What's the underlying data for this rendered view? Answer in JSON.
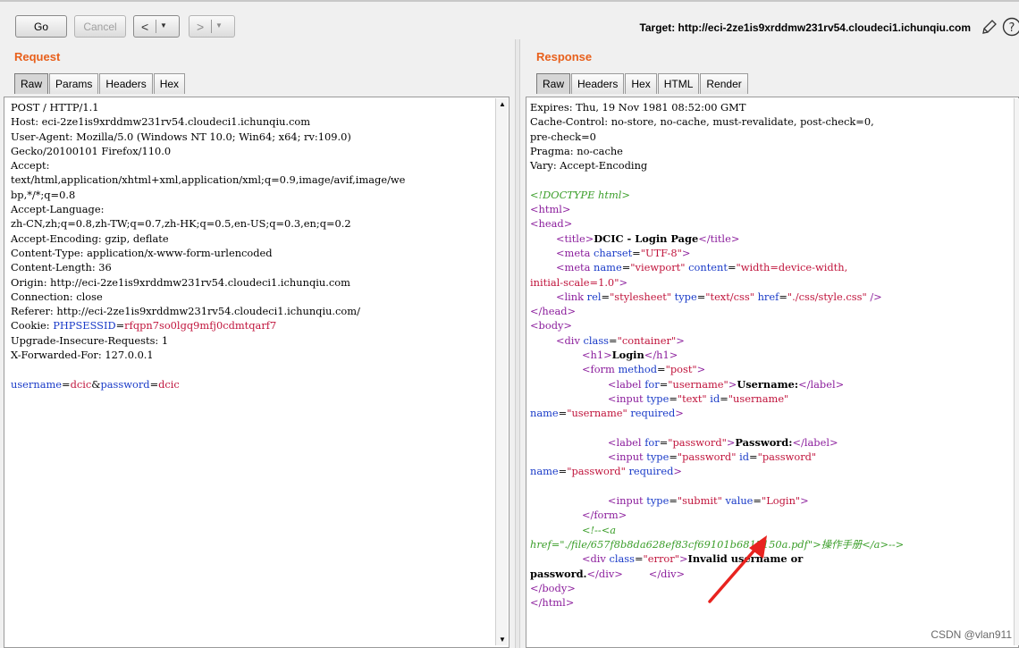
{
  "toolbar": {
    "go_label": "Go",
    "cancel_label": "Cancel",
    "back_label": "<",
    "forward_label": ">",
    "target_label": "Target: http://eci-2ze1is9xrddmw231rv54.cloudeci1.ichunqiu.com"
  },
  "request": {
    "title": "Request",
    "tabs": [
      "Raw",
      "Params",
      "Headers",
      "Hex"
    ],
    "lines": [
      "POST / HTTP/1.1",
      "Host: eci-2ze1is9xrddmw231rv54.cloudeci1.ichunqiu.com",
      "User-Agent: Mozilla/5.0 (Windows NT 10.0; Win64; x64; rv:109.0)",
      "Gecko/20100101 Firefox/110.0",
      "Accept:",
      "text/html,application/xhtml+xml,application/xml;q=0.9,image/avif,image/we",
      "bp,*/*;q=0.8",
      "Accept-Language:",
      "zh-CN,zh;q=0.8,zh-TW;q=0.7,zh-HK;q=0.5,en-US;q=0.3,en;q=0.2",
      "Accept-Encoding: gzip, deflate",
      "Content-Type: application/x-www-form-urlencoded",
      "Content-Length: 36",
      "Origin: http://eci-2ze1is9xrddmw231rv54.cloudeci1.ichunqiu.com",
      "Connection: close",
      "Referer: http://eci-2ze1is9xrddmw231rv54.cloudeci1.ichunqiu.com/"
    ],
    "cookie_label": "Cookie: ",
    "cookie_name": "PHPSESSID",
    "cookie_value": "rfqpn7so0lgq9mfj0cdmtqarf7",
    "lines_after": [
      "Upgrade-Insecure-Requests: 1",
      "X-Forwarded-For: 127.0.0.1",
      ""
    ],
    "body_k1": "username",
    "body_v1": "dcic",
    "body_amp": "&",
    "body_k2": "password",
    "body_v2": "dcic"
  },
  "response": {
    "title": "Response",
    "tabs": [
      "Raw",
      "Headers",
      "Hex",
      "HTML",
      "Render"
    ],
    "headers": [
      "Expires: Thu, 19 Nov 1981 08:52:00 GMT",
      "Cache-Control: no-store, no-cache, must-revalidate, post-check=0,",
      "pre-check=0",
      "Pragma: no-cache",
      "Vary: Accept-Encoding",
      ""
    ],
    "doctype": "<!DOCTYPE html>",
    "html_open": "<html>",
    "head_open": "<head>",
    "title_text": "DCIC - Login Page",
    "charset": "UTF-8",
    "viewport_name": "viewport",
    "viewport_content_1": "width=device-width,",
    "viewport_content_2": "initial-scale=1.0",
    "css_href": "./css/style.css",
    "container_class": "container",
    "h1_text": "Login",
    "form_method": "post",
    "label_username": "Username:",
    "label_password": "Password:",
    "submit_value": "Login",
    "comment_1": "<!--<a",
    "comment_href": "./file/657f8b8da628ef83cf69101b6817150a.pdf",
    "comment_text": "操作手册",
    "error_class": "error",
    "error_text_1": "Invalid username or",
    "error_text_2": "password."
  },
  "watermark": "CSDN @vlan911",
  "colors": {
    "accent": "#e8601c",
    "tag": "#8b1d9c",
    "attr_name": "#1a3bc8",
    "attr_value": "#c0143c",
    "comment": "#3b9e2a"
  }
}
